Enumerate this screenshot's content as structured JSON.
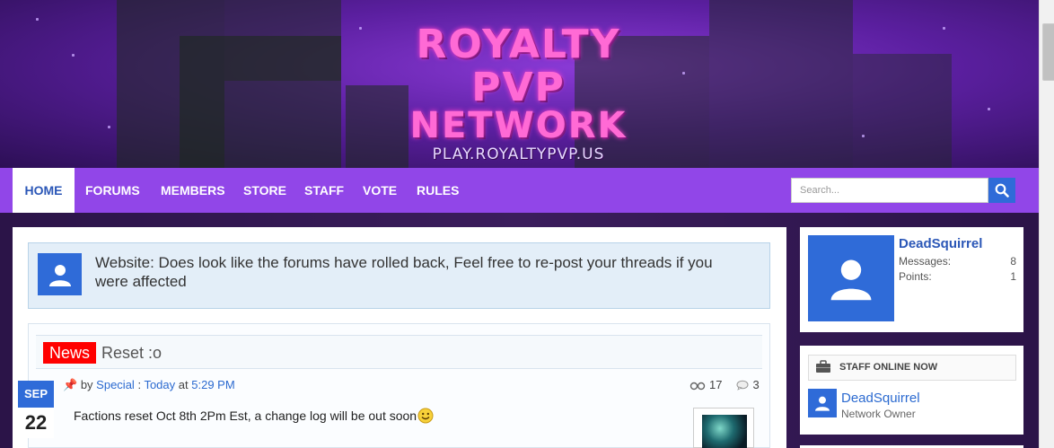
{
  "logo": {
    "line1": "ROYALTY PVP",
    "line2": "NETWORK",
    "line3": "PLAY.ROYALTYPVP.US"
  },
  "nav": {
    "items": [
      {
        "label": "HOME",
        "active": true
      },
      {
        "label": "FORUMS"
      },
      {
        "label": "MEMBERS"
      },
      {
        "label": "STORE"
      },
      {
        "label": "STAFF"
      },
      {
        "label": "VOTE"
      },
      {
        "label": "RULES"
      }
    ]
  },
  "search": {
    "placeholder": "Search..."
  },
  "notice": {
    "text": "Website: Does look like the forums have rolled back, Feel free to re-post your threads if you were affected"
  },
  "news": {
    "tag": "News",
    "title": "Reset :o",
    "date_month": "SEP",
    "date_day": "22",
    "by": "by",
    "author": "Special",
    "sep": ":",
    "day": "Today",
    "at": "at",
    "time": "5:29 PM",
    "views": "17",
    "replies": "3",
    "body": "Factions reset Oct 8th 2Pm Est, a change log will be out soon"
  },
  "user": {
    "name": "DeadSquirrel",
    "messages_label": "Messages:",
    "messages": "8",
    "points_label": "Points:",
    "points": "1"
  },
  "staff": {
    "header": "STAFF ONLINE NOW",
    "name": "DeadSquirrel",
    "role": "Network Owner"
  },
  "colors": {
    "accent": "#9146e8",
    "link": "#2b57b7",
    "news_tag": "#ff0000",
    "avatar": "#2f6bd8"
  }
}
